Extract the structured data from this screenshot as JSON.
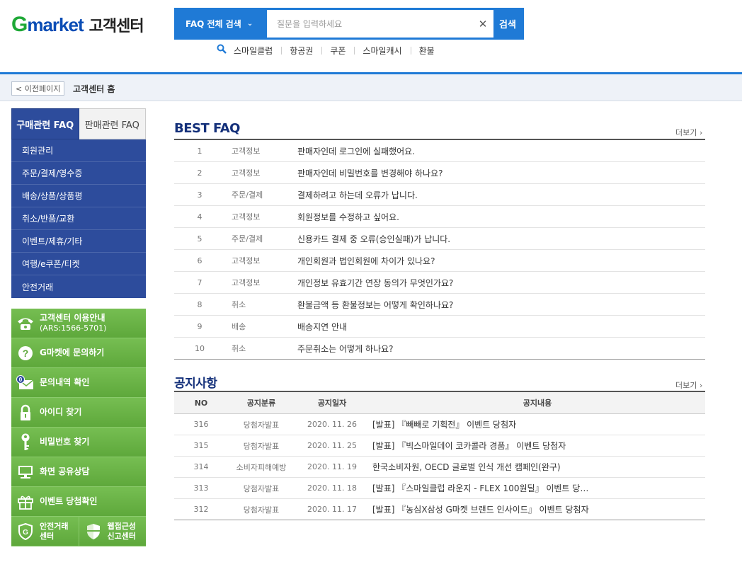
{
  "header": {
    "logo_g": "G",
    "logo_market": "market",
    "logo_cs": "고객센터",
    "search_select": "FAQ 전체 검색",
    "search_placeholder": "질문을 입력하세요",
    "search_button": "검색",
    "quicklinks": [
      "스마일클럽",
      "항공권",
      "쿠폰",
      "스마일캐시",
      "환불"
    ]
  },
  "breadcrumb": {
    "back": "< 이전페이지",
    "title": "고객센터 홈"
  },
  "sidebar": {
    "tabs": [
      "구매관련 FAQ",
      "판매관련 FAQ"
    ],
    "menu": [
      "회원관리",
      "주문/결제/영수증",
      "배송/상품/상품평",
      "취소/반품/교환",
      "이벤트/제휴/기타",
      "여행/e쿠폰/티켓",
      "안전거래"
    ],
    "services": [
      {
        "label": "고객센터 이용안내",
        "sub": "(ARS:1566-5701)",
        "icon": "phone-icon"
      },
      {
        "label": "G마켓에 문의하기",
        "icon": "question-icon"
      },
      {
        "label": "문의내역 확인",
        "icon": "mail-icon",
        "badge": "0"
      },
      {
        "label": "아이디 찾기",
        "icon": "lock-icon"
      },
      {
        "label": "비밀번호 찾기",
        "icon": "key-icon"
      },
      {
        "label": "화면 공유상담",
        "icon": "monitor-icon"
      },
      {
        "label": "이벤트 당첨확인",
        "icon": "gift-icon"
      }
    ],
    "split": [
      {
        "label1": "안전거래",
        "label2": "센터",
        "icon": "shield-g-icon"
      },
      {
        "label1": "웹접근성",
        "label2": "신고센터",
        "icon": "shield-icon"
      }
    ]
  },
  "best_faq": {
    "title": "BEST FAQ",
    "more": "더보기 ›",
    "rows": [
      {
        "no": "1",
        "cat": "고객정보",
        "q": "판매자인데 로그인에 실패했어요."
      },
      {
        "no": "2",
        "cat": "고객정보",
        "q": "판매자인데 비밀번호를 변경해야 하나요?"
      },
      {
        "no": "3",
        "cat": "주문/결제",
        "q": "결제하려고 하는데 오류가 납니다."
      },
      {
        "no": "4",
        "cat": "고객정보",
        "q": "회원정보를 수정하고 싶어요."
      },
      {
        "no": "5",
        "cat": "주문/결제",
        "q": "신용카드 결제 중 오류(승인실패)가 납니다."
      },
      {
        "no": "6",
        "cat": "고객정보",
        "q": "개인회원과 법인회원에 차이가 있나요?"
      },
      {
        "no": "7",
        "cat": "고객정보",
        "q": "개인정보 유효기간 연장 동의가 무엇인가요?"
      },
      {
        "no": "8",
        "cat": "취소",
        "q": "환불금액 등 환불정보는 어떻게 확인하나요?"
      },
      {
        "no": "9",
        "cat": "배송",
        "q": "배송지연 안내"
      },
      {
        "no": "10",
        "cat": "취소",
        "q": "주문취소는 어떻게 하나요?"
      }
    ]
  },
  "notices": {
    "title": "공지사항",
    "more": "더보기 ›",
    "headers": {
      "no": "NO",
      "cat": "공지분류",
      "date": "공지일자",
      "title": "공지내용"
    },
    "rows": [
      {
        "no": "316",
        "cat": "당첨자발표",
        "date": "2020. 11. 26",
        "title": "[발표] 『빼빼로 기획전』 이벤트 당첨자"
      },
      {
        "no": "315",
        "cat": "당첨자발표",
        "date": "2020. 11. 25",
        "title": "[발표] 『빅스마일데이 코카콜라 경품』 이벤트 당첨자"
      },
      {
        "no": "314",
        "cat": "소비자피해예방",
        "date": "2020. 11. 19",
        "title": "한국소비자원, OECD 글로벌 인식 개선 캠페인(완구)"
      },
      {
        "no": "313",
        "cat": "당첨자발표",
        "date": "2020. 11. 18",
        "title": "[발표] 『스마일클럽 라운지 - FLEX 100원딜』 이벤트 당…"
      },
      {
        "no": "312",
        "cat": "당첨자발표",
        "date": "2020. 11. 17",
        "title": "[발표] 『농심X삼성 G마켓 브랜드 인사이드』 이벤트 당첨자"
      }
    ]
  }
}
